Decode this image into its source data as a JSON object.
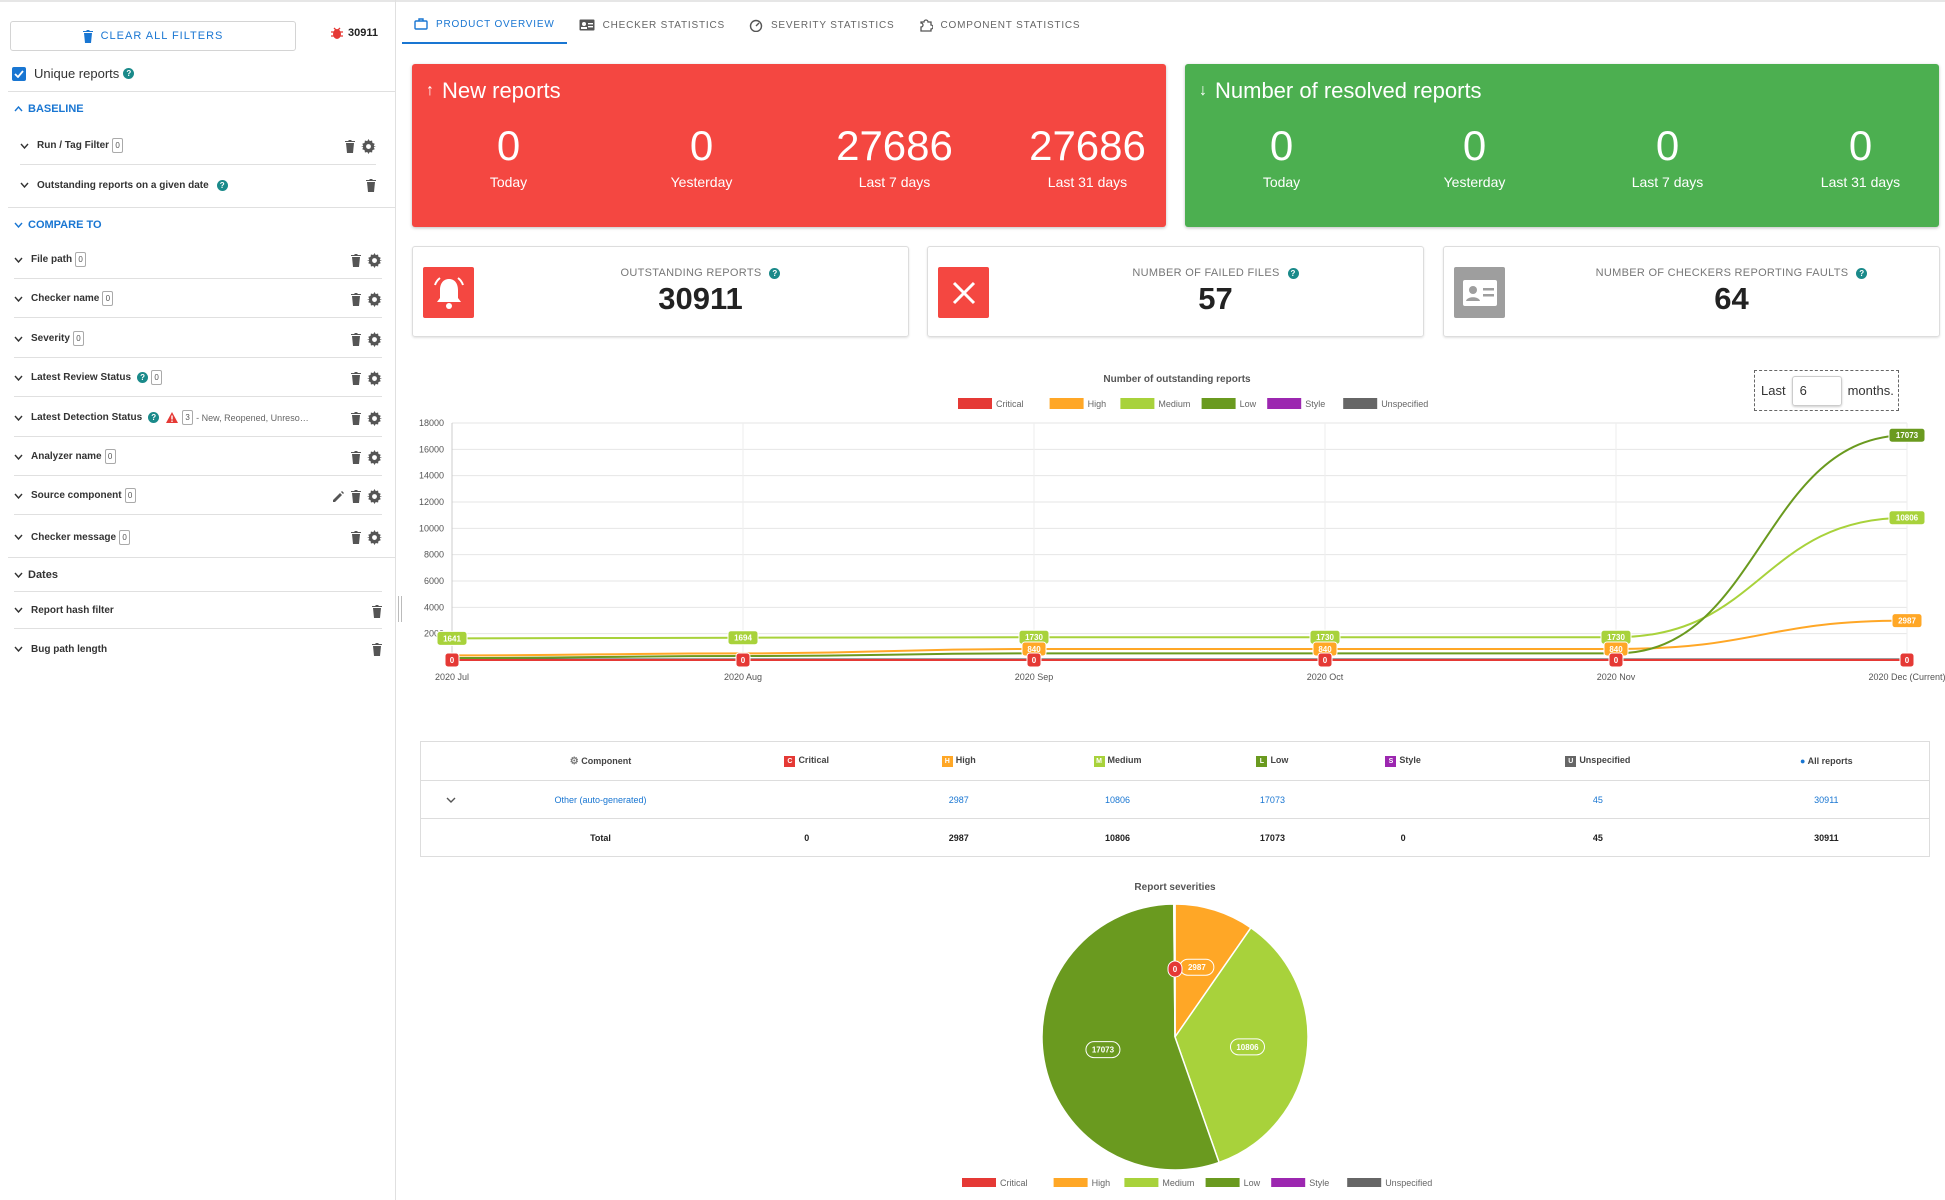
{
  "sidebar": {
    "clear_label": "Clear all filters",
    "total_count": "30911",
    "unique_label": "Unique reports",
    "baseline_header": "Baseline",
    "run_tag_filter": "Run / Tag Filter",
    "run_tag_count": "0",
    "outstanding_date": "Outstanding reports on a given date",
    "compare_header": "Compare to",
    "filters": [
      {
        "label": "File path",
        "count": "0"
      },
      {
        "label": "Checker name",
        "count": "0"
      },
      {
        "label": "Severity",
        "count": "0"
      },
      {
        "label": "Latest Review Status",
        "count": "0"
      },
      {
        "label": "Latest Detection Status",
        "count": "3",
        "extra": "- New, Reopened, Unreso…"
      },
      {
        "label": "Analyzer name",
        "count": "0"
      },
      {
        "label": "Source component",
        "count": "0"
      },
      {
        "label": "Checker message",
        "count": "0"
      }
    ],
    "dates_header": "Dates",
    "report_hash": "Report hash filter",
    "bug_path": "Bug path length"
  },
  "tabs": [
    "Product overview",
    "Checker statistics",
    "Severity statistics",
    "Component statistics"
  ],
  "new_reports": {
    "title": "New reports",
    "stats": [
      {
        "value": "0",
        "label": "Today"
      },
      {
        "value": "0",
        "label": "Yesterday"
      },
      {
        "value": "27686",
        "label": "Last 7 days"
      },
      {
        "value": "27686",
        "label": "Last 31 days"
      }
    ]
  },
  "resolved_reports": {
    "title": "Number of resolved reports",
    "stats": [
      {
        "value": "0",
        "label": "Today"
      },
      {
        "value": "0",
        "label": "Yesterday"
      },
      {
        "value": "0",
        "label": "Last 7 days"
      },
      {
        "value": "0",
        "label": "Last 31 days"
      }
    ]
  },
  "kpis": [
    {
      "label": "Outstanding reports",
      "value": "30911"
    },
    {
      "label": "Number of failed files",
      "value": "57"
    },
    {
      "label": "Number of checkers reporting faults",
      "value": "64"
    }
  ],
  "months_selector": {
    "prefix": "Last",
    "value": "6",
    "suffix": "months."
  },
  "colors": {
    "critical": "#e53935",
    "high": "#ffa726",
    "medium": "#a8d23b",
    "low": "#6a9a1f",
    "style": "#9c27b0",
    "unspecified": "#666666",
    "red_card": "#f44741",
    "green_card": "#4caf50",
    "accent": "#1976d2"
  },
  "chart_data": [
    {
      "type": "line",
      "title": "Number of outstanding reports",
      "x": [
        "2020 Jul",
        "2020 Aug",
        "2020 Sep",
        "2020 Oct",
        "2020 Nov",
        "2020 Dec (Current)"
      ],
      "ylim": [
        0,
        18000
      ],
      "yticks": [
        0,
        2000,
        4000,
        6000,
        8000,
        10000,
        12000,
        14000,
        16000,
        18000
      ],
      "grid": true,
      "legend": "top",
      "series": [
        {
          "name": "Critical",
          "color": "#e53935",
          "values": [
            0,
            0,
            0,
            0,
            0,
            0
          ]
        },
        {
          "name": "High",
          "color": "#ffa726",
          "values": [
            350,
            500,
            840,
            840,
            840,
            2987
          ]
        },
        {
          "name": "Medium",
          "color": "#a8d23b",
          "values": [
            1641,
            1694,
            1730,
            1730,
            1730,
            10806
          ]
        },
        {
          "name": "Low",
          "color": "#6a9a1f",
          "values": [
            150,
            300,
            500,
            500,
            500,
            17073
          ]
        },
        {
          "name": "Style",
          "color": "#9c27b0",
          "values": [
            0,
            0,
            0,
            0,
            0,
            0
          ]
        },
        {
          "name": "Unspecified",
          "color": "#666666",
          "values": [
            45,
            45,
            45,
            45,
            45,
            45
          ]
        }
      ],
      "labels": {
        "Medium": [
          "1641",
          "1694",
          "1730",
          "1730",
          "1730",
          "10806"
        ],
        "High": [
          "",
          "",
          "840",
          "840",
          "840",
          "2987"
        ],
        "Low": [
          "",
          "",
          "",
          "",
          "",
          "17073"
        ],
        "Critical": [
          "0",
          "0",
          "0",
          "0",
          "0",
          "0"
        ]
      }
    },
    {
      "type": "pie",
      "title": "Report severities",
      "legend": "bottom",
      "slices": [
        {
          "name": "Critical",
          "value": 0,
          "color": "#e53935"
        },
        {
          "name": "High",
          "value": 2987,
          "color": "#ffa726"
        },
        {
          "name": "Medium",
          "value": 10806,
          "color": "#a8d23b"
        },
        {
          "name": "Low",
          "value": 17073,
          "color": "#6a9a1f"
        },
        {
          "name": "Style",
          "value": 0,
          "color": "#9c27b0"
        },
        {
          "name": "Unspecified",
          "value": 45,
          "color": "#666666"
        }
      ]
    }
  ],
  "table": {
    "headers": [
      "Component",
      "Critical",
      "High",
      "Medium",
      "Low",
      "Style",
      "Unspecified",
      "All reports"
    ],
    "header_badges": [
      "",
      "C",
      "H",
      "M",
      "L",
      "S",
      "U",
      ""
    ],
    "rows": [
      {
        "name": "Other (auto-generated)",
        "critical": "",
        "high": "2987",
        "medium": "10806",
        "low": "17073",
        "style": "",
        "unspecified": "45",
        "all": "30911"
      }
    ],
    "total": {
      "name": "Total",
      "critical": "0",
      "high": "2987",
      "medium": "10806",
      "low": "17073",
      "style": "0",
      "unspecified": "45",
      "all": "30911"
    }
  }
}
